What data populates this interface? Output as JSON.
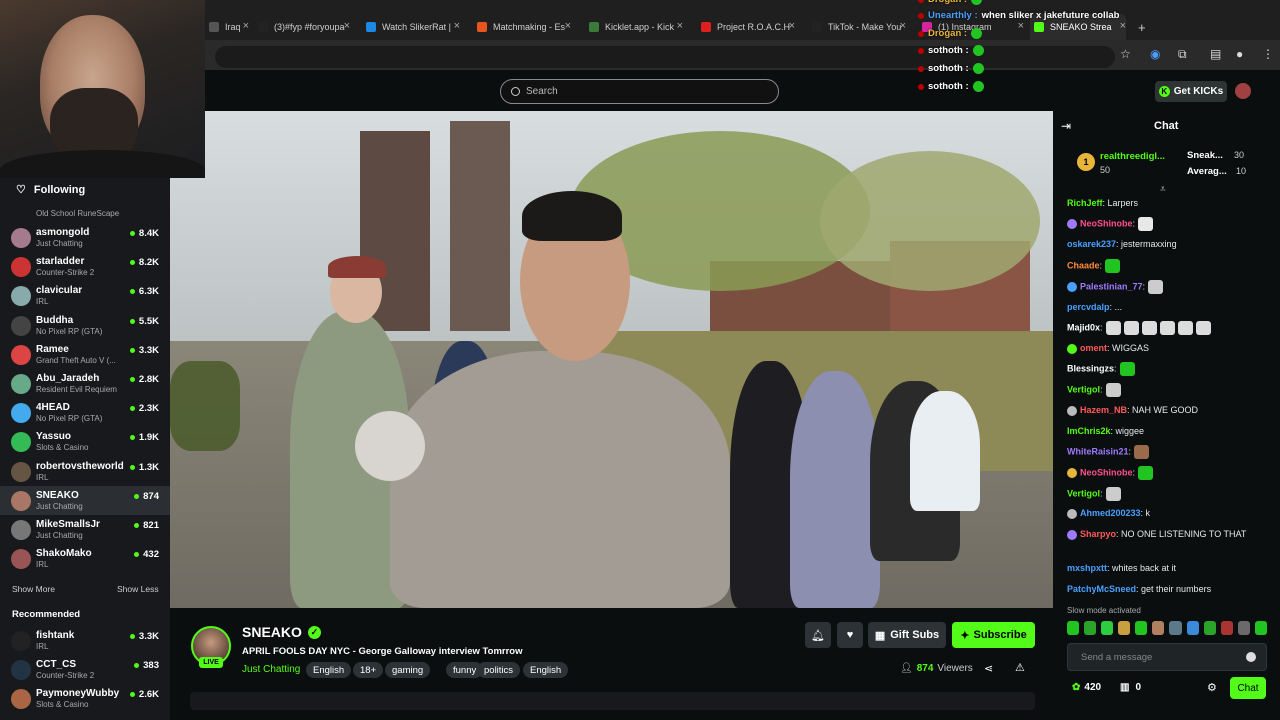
{
  "browser": {
    "tabs": [
      {
        "label": "Iraq",
        "color": "#555"
      },
      {
        "label": "(3)#fyp #foryoupa",
        "color": "#222"
      },
      {
        "label": "Watch SlikerRat |",
        "color": "#1e88e5"
      },
      {
        "label": "Matchmaking - Es",
        "color": "#e8551c"
      },
      {
        "label": "Kicklet.app - Kick",
        "color": "#3b7a3b"
      },
      {
        "label": "Project R.O.A.C.H",
        "color": "#e02020"
      },
      {
        "label": "TikTok - Make You",
        "color": "#222"
      },
      {
        "label": "(1) Instagram",
        "color": "#d6249f"
      },
      {
        "label": "SNEAKO Strea",
        "color": "#53fc18"
      }
    ],
    "new_tab": "+"
  },
  "overlay_chat": [
    {
      "user": "Drogan :",
      "text": "",
      "color": "#e7b53a"
    },
    {
      "user": "Unearthly :",
      "text": "when sliker x jakefuture collab",
      "color": "#4aa0ff"
    },
    {
      "user": "Drogan :",
      "text": "",
      "color": "#e7b53a"
    },
    {
      "user": "sothoth :",
      "text": "",
      "color": "#ffffff"
    },
    {
      "user": "sothoth :",
      "text": "",
      "color": "#ffffff"
    },
    {
      "user": "sothoth :",
      "text": "",
      "color": "#ffffff"
    }
  ],
  "topbar": {
    "search_placeholder": "Search",
    "get_kicks": "Get KICKs"
  },
  "sidebar": {
    "following_label": "Following",
    "top_partial": "Old School RuneScape",
    "channels": [
      {
        "name": "asmongold",
        "game": "Just Chatting",
        "viewers": "8.4K",
        "color": "#a57a8c"
      },
      {
        "name": "starladder",
        "game": "Counter-Strike 2",
        "viewers": "8.2K",
        "color": "#c33"
      },
      {
        "name": "clavicular",
        "game": "IRL",
        "viewers": "6.3K",
        "color": "#8aa"
      },
      {
        "name": "Buddha",
        "game": "No Pixel RP (GTA)",
        "viewers": "5.5K",
        "color": "#444"
      },
      {
        "name": "Ramee",
        "game": "Grand Theft Auto V (...",
        "viewers": "3.3K",
        "color": "#d44"
      },
      {
        "name": "Abu_Jaradeh",
        "game": "Resident Evil Requiem",
        "viewers": "2.8K",
        "color": "#6a8"
      },
      {
        "name": "4HEAD",
        "game": "No Pixel RP (GTA)",
        "viewers": "2.3K",
        "color": "#4ae"
      },
      {
        "name": "Yassuo",
        "game": "Slots & Casino",
        "viewers": "1.9K",
        "color": "#3b5"
      },
      {
        "name": "robertovstheworld",
        "game": "IRL",
        "viewers": "1.3K",
        "color": "#654"
      },
      {
        "name": "SNEAKO",
        "game": "Just Chatting",
        "viewers": "874",
        "color": "#a76"
      },
      {
        "name": "MikeSmallsJr",
        "game": "Just Chatting",
        "viewers": "821",
        "color": "#777"
      },
      {
        "name": "ShakoMako",
        "game": "IRL",
        "viewers": "432",
        "color": "#955"
      }
    ],
    "show_more": "Show More",
    "show_less": "Show Less",
    "recommended_label": "Recommended",
    "recommended": [
      {
        "name": "fishtank",
        "game": "IRL",
        "viewers": "3.3K",
        "color": "#222"
      },
      {
        "name": "CCT_CS",
        "game": "Counter-Strike 2",
        "viewers": "383",
        "color": "#234"
      },
      {
        "name": "PaymoneyWubby",
        "game": "Slots & Casino",
        "viewers": "2.6K",
        "color": "#a64"
      }
    ]
  },
  "stream": {
    "channel": "SNEAKO",
    "live_label": "LIVE",
    "title": "APRIL FOOLS DAY NYC - George Galloway interview Tomrrow",
    "category": "Just Chatting",
    "tags": [
      "English",
      "18+",
      "gaming",
      "funny",
      "politics",
      "English"
    ],
    "gift_subs": "Gift Subs",
    "subscribe": "Subscribe",
    "viewers": "874",
    "viewers_label": "Viewers"
  },
  "chat": {
    "title": "Chat",
    "leaderboard": {
      "rank": "1",
      "first_name": "realthreedigl...",
      "first_value": "50",
      "second_name": "Sneak...",
      "second_value": "30",
      "third_name": "Averag...",
      "third_value": "10"
    },
    "messages": [
      {
        "user": "RichJeff",
        "text": ": Larpers",
        "color": "#53fc18",
        "emotes": 0
      },
      {
        "user": "NeoShinobe",
        "text": ":",
        "color": "#ff4f8a",
        "emotes": 1
      },
      {
        "user": "oskarek237",
        "text": ": jestermaxxing",
        "color": "#4aa0ff",
        "emotes": 0
      },
      {
        "user": "Chaade",
        "text": ":",
        "color": "#ff8a3a",
        "emotes": 1
      },
      {
        "user": "Palestinian_77",
        "text": ":",
        "color": "#9f7aff",
        "emotes": 1
      },
      {
        "user": "percvdalp",
        "text": ": ...",
        "color": "#4aa0ff",
        "emotes": 0
      },
      {
        "user": "Majid0x",
        "text": ":",
        "color": "#ffffff",
        "emotes": 6
      },
      {
        "user": "oment",
        "text": ": WIGGAS",
        "color": "#ff5a5a",
        "emotes": 0
      },
      {
        "user": "Blessingzs",
        "text": ":",
        "color": "#ffffff",
        "emotes": 1
      },
      {
        "user": "Vertigol",
        "text": ":",
        "color": "#53fc18",
        "emotes": 1
      },
      {
        "user": "Hazem_NB",
        "text": ": NAH WE GOOD",
        "color": "#ff5a5a",
        "emotes": 0
      },
      {
        "user": "ImChris2k",
        "text": ": wiggee",
        "color": "#53fc18",
        "emotes": 0
      },
      {
        "user": "WhiteRaisin21",
        "text": ":",
        "color": "#9f7aff",
        "emotes": 1
      },
      {
        "user": "NeoShinobe",
        "text": ":",
        "color": "#ff4f8a",
        "emotes": 1
      },
      {
        "user": "Vertigol",
        "text": ":",
        "color": "#53fc18",
        "emotes": 1
      },
      {
        "user": "Ahmed200233",
        "text": ": k",
        "color": "#4aa0ff",
        "emotes": 0
      },
      {
        "user": "Sharpyo",
        "text": ": NO ONE LISTENING TO THAT",
        "color": "#ff5a5a",
        "emotes": 0
      },
      {
        "user": "mxshpxtt",
        "text": ": whites back at it",
        "color": "#4aa0ff",
        "emotes": 0
      },
      {
        "user": "PatchyMcSneed",
        "text": ": get their numbers",
        "color": "#4aa0ff",
        "emotes": 0
      }
    ],
    "slow_mode": "Slow mode activated",
    "input_placeholder": "Send a message",
    "points": "420",
    "gifts": "0",
    "send_label": "Chat"
  }
}
